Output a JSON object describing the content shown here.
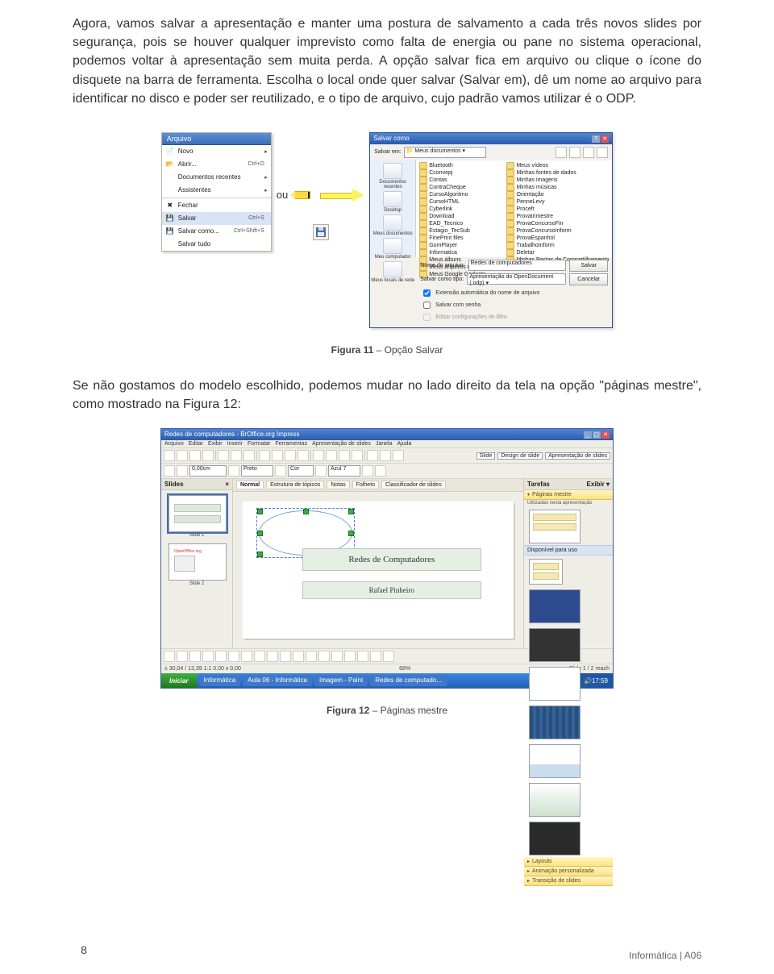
{
  "paragraph": "Agora, vamos salvar a apresentação e manter uma postura de salvamento a cada três novos slides por segurança, pois se houver qualquer imprevisto como falta de energia ou pane no sistema operacional, podemos voltar à apresentação sem muita perda. A opção salvar fica em arquivo ou clique o ícone do disquete na barra de ferramenta. Escolha o local onde quer salvar (Salvar em), dê um nome ao arquivo para identificar no disco e poder ser reutilizado, e o tipo de arquivo, cujo padrão vamos utilizar é o ODP.",
  "middle_paragraph": "Se não gostamos do modelo escolhido, podemos mudar no lado direito da tela na opção \"páginas mestre\", como mostrado na Figura 12:",
  "fig11": {
    "label": "Figura 11",
    "desc": " – Opção Salvar"
  },
  "fig12": {
    "label": "Figura 12",
    "desc": " – Páginas mestre"
  },
  "ou": "ou",
  "file_menu": {
    "title": "Arquivo",
    "items": [
      {
        "icon": "📄",
        "label": "Novo",
        "shortcut": "",
        "arrow": "▸"
      },
      {
        "icon": "📂",
        "label": "Abrir...",
        "shortcut": "Ctrl+O",
        "arrow": ""
      },
      {
        "icon": "",
        "label": "Documentos recentes",
        "shortcut": "",
        "arrow": "▸"
      },
      {
        "icon": "",
        "label": "Assistentes",
        "shortcut": "",
        "arrow": "▸"
      },
      {
        "sep": true
      },
      {
        "icon": "✖",
        "label": "Fechar",
        "shortcut": "",
        "arrow": ""
      },
      {
        "icon": "💾",
        "label": "Salvar",
        "shortcut": "Ctrl+S",
        "arrow": "",
        "sel": true
      },
      {
        "icon": "💾",
        "label": "Salvar como...",
        "shortcut": "Ctrl+Shift+S",
        "arrow": ""
      },
      {
        "icon": "",
        "label": "Salvar tudo",
        "shortcut": "",
        "arrow": ""
      }
    ]
  },
  "saveas": {
    "title": "Salvar como",
    "save_in_label": "Salvar em:",
    "save_in_value": "Meus documentos",
    "side": [
      "Documentos recentes",
      "Desktop",
      "Meus documentos",
      "Meu computador",
      "Meus locais de rede"
    ],
    "col1": [
      "Bluetooth",
      "Cconvepj",
      "Contas",
      "ContraCheque",
      "CursoAlgoritmo",
      "CursoHTML",
      "Cyberlink",
      "Download",
      "EAD_Tecnico",
      "Estagio_TecSub",
      "FinePrint files",
      "GomPlayer",
      "Informatica",
      "Meus álbuns",
      "Meus arquivos recebidos",
      "Meus Google Gadgets"
    ],
    "col2": [
      "Meus vídeos",
      "Minhas fontes de dados",
      "Minhas imagens",
      "Minhas músicas",
      "Orientação",
      "PenneLevy",
      "Procefr",
      "Provatrimestre",
      "ProvaConcursoFin",
      "ProvaConcursoInform",
      "ProvaEspanhol",
      "TrabalhoInform",
      "Deletar",
      "Minhas Pastas de Compartilhamento"
    ],
    "filename_label": "Nome do arquivo:",
    "filename_value": "Redes de computadores",
    "type_label": "Salvar como tipo:",
    "type_value": "Apresentação do OpenDocument (.odp)",
    "btn_save": "Salvar",
    "btn_cancel": "Cancelar",
    "chk_auto": "Extensão automática do nome de arquivo",
    "chk_pwd": "Salvar com senha",
    "chk_filter": "Editar configurações de filtro"
  },
  "impress": {
    "title": "Redes de computadores - BrOffice.org Impress",
    "menus": [
      "Arquivo",
      "Editar",
      "Exibir",
      "Inserir",
      "Formatar",
      "Ferramentas",
      "Apresentação de slides",
      "Janela",
      "Ajuda"
    ],
    "tool_text": [
      "0,00cm",
      "Preto",
      "Cor",
      "Azul 7"
    ],
    "right_buttons": [
      "Slide",
      "Design de slide",
      "Apresentação de slides"
    ],
    "slides_head": "Slides",
    "tabs": [
      "Normal",
      "Estrutura de tópicos",
      "Notas",
      "Folheto",
      "Classificador de slides"
    ],
    "slide1_cap": "Slide 1",
    "slide2_cap": "Slide 2",
    "slide_title": "Redes de Computadores",
    "slide_sub": "Rafael Pinheiro",
    "slide2_thumb_label": "OpenOffice.org",
    "tasks_head": "Tarefas",
    "tasks_exibir": "Exibir ▾",
    "sec_master": "Páginas mestre",
    "sub_used": "Utilizadas nesta apresentação",
    "sub_avail": "Disponível para uso",
    "sec_layouts": "Layouts",
    "sec_anim": "Animação personalizada",
    "sec_trans": "Transição de slides",
    "status_left": "± 30,04 / 13,39   1:1 0,00 x 0,00",
    "status_mid": "68%",
    "status_right": "Slide 1 / 2          reach",
    "taskbar": {
      "start": "Iniciar",
      "items": [
        "Informática",
        "Aula 06 - Informática",
        "Imagem - Paint",
        "Redes de computado..."
      ],
      "clock": "17:59"
    }
  },
  "footer": {
    "page": "8",
    "course": "Informática | A06"
  }
}
